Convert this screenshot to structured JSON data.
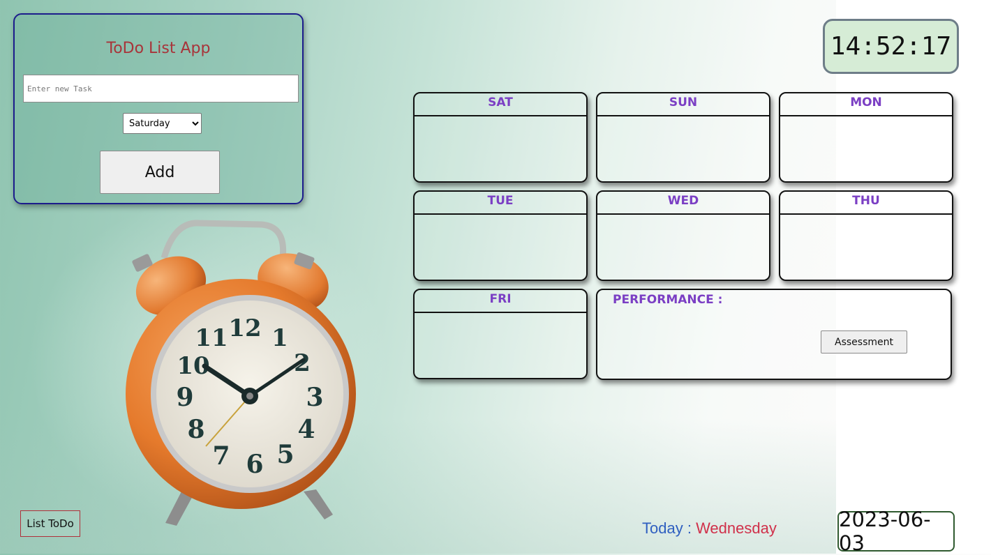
{
  "app": {
    "title": "ToDo List App"
  },
  "form": {
    "task_placeholder": "Enter new Task",
    "day_selected": "Saturday",
    "add_label": "Add"
  },
  "clock": {
    "time": "14:52:17"
  },
  "days": [
    "SAT",
    "SUN",
    "MON",
    "TUE",
    "WED",
    "THU",
    "FRI"
  ],
  "performance": {
    "label": "PERFORMANCE :",
    "assess_label": "Assessment"
  },
  "footer": {
    "list_label": "List ToDo",
    "today_label": "Today :",
    "today_value": "Wednesday",
    "date": "2023-06-03"
  },
  "colors": {
    "accent_purple": "#7b3fc4",
    "title_red": "#a8343a",
    "panel_border": "#1c1c8c"
  },
  "illustration": {
    "icon": "alarm-clock-icon"
  }
}
